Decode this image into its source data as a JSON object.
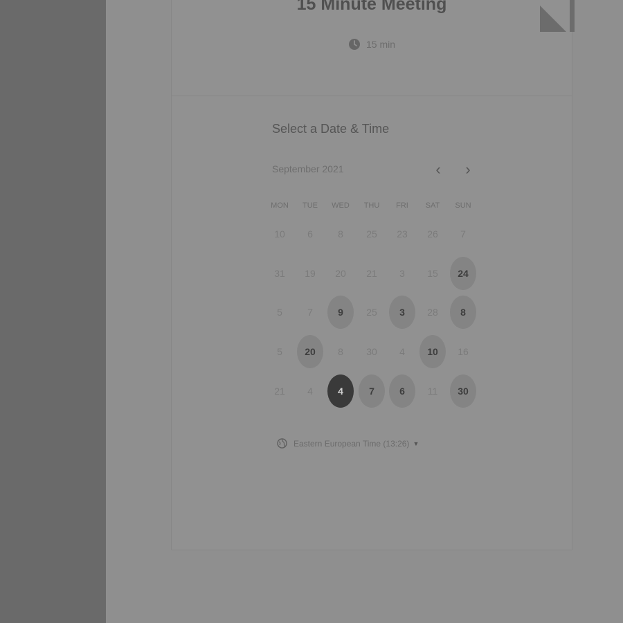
{
  "event": {
    "title": "15 Minute Meeting",
    "duration": "15 min"
  },
  "scheduler": {
    "heading": "Select a Date & Time",
    "month": "September 2021",
    "prev_icon": "chevron-left-icon",
    "next_icon": "chevron-right-icon",
    "weekdays": [
      "MON",
      "TUE",
      "WED",
      "THU",
      "FRI",
      "SAT",
      "SUN"
    ],
    "weeks": [
      [
        {
          "label": "10",
          "state": "unavailable"
        },
        {
          "label": "6",
          "state": "unavailable"
        },
        {
          "label": "8",
          "state": "unavailable"
        },
        {
          "label": "25",
          "state": "unavailable"
        },
        {
          "label": "23",
          "state": "unavailable"
        },
        {
          "label": "26",
          "state": "unavailable"
        },
        {
          "label": "7",
          "state": "unavailable"
        }
      ],
      [
        {
          "label": "31",
          "state": "unavailable"
        },
        {
          "label": "19",
          "state": "unavailable"
        },
        {
          "label": "20",
          "state": "unavailable"
        },
        {
          "label": "21",
          "state": "unavailable"
        },
        {
          "label": "3",
          "state": "unavailable"
        },
        {
          "label": "15",
          "state": "unavailable"
        },
        {
          "label": "24",
          "state": "available"
        }
      ],
      [
        {
          "label": "5",
          "state": "unavailable"
        },
        {
          "label": "7",
          "state": "unavailable"
        },
        {
          "label": "9",
          "state": "available"
        },
        {
          "label": "25",
          "state": "unavailable"
        },
        {
          "label": "3",
          "state": "available"
        },
        {
          "label": "28",
          "state": "unavailable"
        },
        {
          "label": "8",
          "state": "available"
        }
      ],
      [
        {
          "label": "5",
          "state": "unavailable"
        },
        {
          "label": "20",
          "state": "available"
        },
        {
          "label": "8",
          "state": "unavailable"
        },
        {
          "label": "30",
          "state": "unavailable"
        },
        {
          "label": "4",
          "state": "unavailable"
        },
        {
          "label": "10",
          "state": "available"
        },
        {
          "label": "16",
          "state": "unavailable"
        }
      ],
      [
        {
          "label": "21",
          "state": "unavailable"
        },
        {
          "label": "4",
          "state": "unavailable"
        },
        {
          "label": "4",
          "state": "selected"
        },
        {
          "label": "7",
          "state": "available"
        },
        {
          "label": "6",
          "state": "available"
        },
        {
          "label": "11",
          "state": "unavailable"
        },
        {
          "label": "30",
          "state": "available"
        }
      ]
    ],
    "timezone": "Eastern European Time (13:26)",
    "timezone_icon": "globe-icon"
  },
  "colors": {
    "overlay": "#6a6a6a",
    "page": "#8f8f8f",
    "selected_day": "#3a3a3a",
    "available_day": "#848484"
  }
}
